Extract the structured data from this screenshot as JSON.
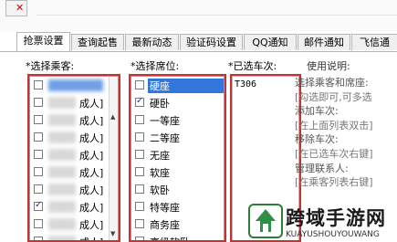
{
  "tabs": [
    {
      "label": "抢票设置",
      "active": true
    },
    {
      "label": "查询起售",
      "active": false
    },
    {
      "label": "最新动态",
      "active": false
    },
    {
      "label": "验证码设置",
      "active": false
    },
    {
      "label": "QQ通知",
      "active": false
    },
    {
      "label": "邮件通知",
      "active": false
    },
    {
      "label": "飞信通",
      "active": false
    }
  ],
  "passengers": {
    "label": "*选择乘客:",
    "rows": [
      {
        "suffix": "",
        "checked": false,
        "selected": true
      },
      {
        "suffix": "成人]",
        "checked": false,
        "selected": false
      },
      {
        "suffix": "成人]",
        "checked": false,
        "selected": false
      },
      {
        "suffix": "成人]",
        "checked": false,
        "selected": false
      },
      {
        "suffix": "成人]",
        "checked": false,
        "selected": false
      },
      {
        "suffix": "成人]",
        "checked": false,
        "selected": false
      },
      {
        "suffix": "成人]",
        "checked": false,
        "selected": false
      },
      {
        "suffix": "成人]",
        "checked": true,
        "selected": false
      },
      {
        "suffix": "成人]",
        "checked": false,
        "selected": false
      },
      {
        "suffix": "成人]",
        "checked": false,
        "selected": false
      }
    ]
  },
  "seats": {
    "label": "*选择席位:",
    "rows": [
      {
        "name": "硬座",
        "checked": false,
        "selected": true
      },
      {
        "name": "硬卧",
        "checked": true,
        "selected": false
      },
      {
        "name": "一等座",
        "checked": false,
        "selected": false
      },
      {
        "name": "二等座",
        "checked": false,
        "selected": false
      },
      {
        "name": "无座",
        "checked": false,
        "selected": false
      },
      {
        "name": "软座",
        "checked": false,
        "selected": false
      },
      {
        "name": "软卧",
        "checked": false,
        "selected": false
      },
      {
        "name": "特等座",
        "checked": false,
        "selected": false
      },
      {
        "name": "商务座",
        "checked": false,
        "selected": false
      },
      {
        "name": "高级软卧",
        "checked": false,
        "selected": false
      }
    ]
  },
  "trains": {
    "label": "*已选车次:",
    "items": [
      "T306"
    ]
  },
  "usage": {
    "label": "使用说明:",
    "lines": [
      "选择乘客和席座:",
      "[勾选即可,可多选",
      "添加车次:",
      "[在上面列表双击]",
      "移除车次:",
      "[在已选车次右键]",
      "管理联系人:",
      "[在乘客列表右键]"
    ]
  },
  "watermark": {
    "cn": "跨域手游网",
    "en": "KUAYUSHOUYOUWANG"
  },
  "colors": {
    "highlight": "#c73232",
    "selection": "#3377dd"
  }
}
